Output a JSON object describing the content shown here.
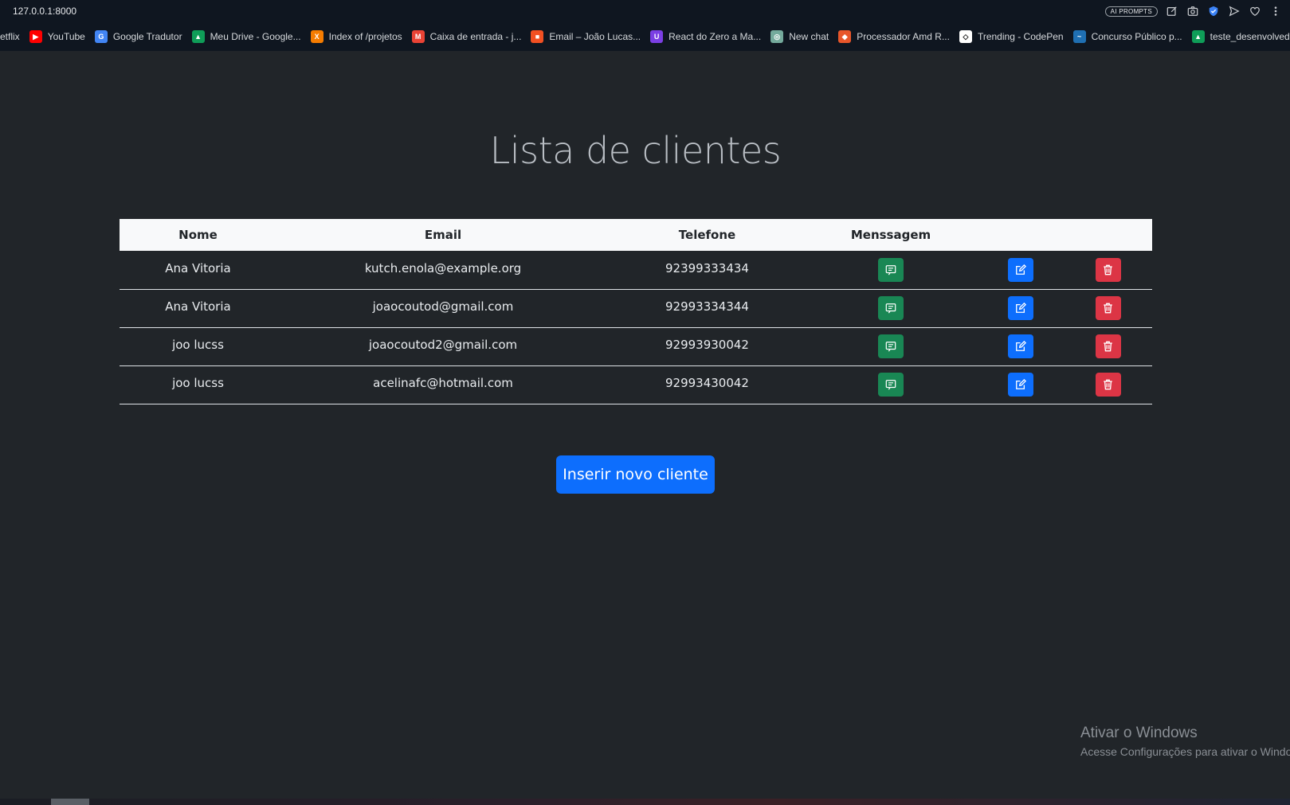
{
  "browser": {
    "url": "127.0.0.1:8000",
    "ai_prompts_label": "AI PROMPTS",
    "bookmarks": [
      {
        "label": "etflix",
        "color": "#e50914",
        "glyph": ""
      },
      {
        "label": "YouTube",
        "color": "#ff0000",
        "glyph": "▶"
      },
      {
        "label": "Google Tradutor",
        "color": "#4285f4",
        "glyph": "G"
      },
      {
        "label": "Meu Drive - Google...",
        "color": "#0f9d58",
        "glyph": "▲"
      },
      {
        "label": "Index of /projetos",
        "color": "#f57c00",
        "glyph": "X"
      },
      {
        "label": "Caixa de entrada - j...",
        "color": "#ea4335",
        "glyph": "M"
      },
      {
        "label": "Email – João Lucas...",
        "color": "#f25022",
        "glyph": "■"
      },
      {
        "label": "React do Zero a Ma...",
        "color": "#7b3fe4",
        "glyph": "U"
      },
      {
        "label": "New chat",
        "color": "#74aa9c",
        "glyph": "◎"
      },
      {
        "label": "Processador Amd R...",
        "color": "#e8562a",
        "glyph": "◆"
      },
      {
        "label": "Trending - CodePen",
        "color": "#ffffff",
        "glyph": "◇"
      },
      {
        "label": "Concurso Público p...",
        "color": "#1f6fb2",
        "glyph": "~"
      },
      {
        "label": "teste_desenvolved...",
        "color": "#0f9d58",
        "glyph": "▲"
      }
    ]
  },
  "page": {
    "title": "Lista de clientes",
    "table": {
      "headers": {
        "nome": "Nome",
        "email": "Email",
        "telefone": "Telefone",
        "mensagem": "Menssagem"
      },
      "rows": [
        {
          "nome": "Ana Vitoria",
          "email": "kutch.enola@example.org",
          "telefone": "92399333434"
        },
        {
          "nome": "Ana Vitoria",
          "email": "joaocoutod@gmail.com",
          "telefone": "92993334344"
        },
        {
          "nome": "joo lucss",
          "email": "joaocoutod2@gmail.com",
          "telefone": "92993930042"
        },
        {
          "nome": "joo lucss",
          "email": "acelinafc@hotmail.com",
          "telefone": "92993430042"
        }
      ]
    },
    "insert_button": "Inserir novo cliente"
  },
  "watermark": {
    "title": "Ativar o Windows",
    "subtitle": "Acesse Configurações para ativar o Windows."
  },
  "colors": {
    "background": "#212529",
    "success": "#198754",
    "primary": "#0d6efd",
    "danger": "#dc3545"
  },
  "icons": {
    "message": "chat-square-text-icon",
    "edit": "pencil-square-icon",
    "delete": "trash-icon"
  }
}
